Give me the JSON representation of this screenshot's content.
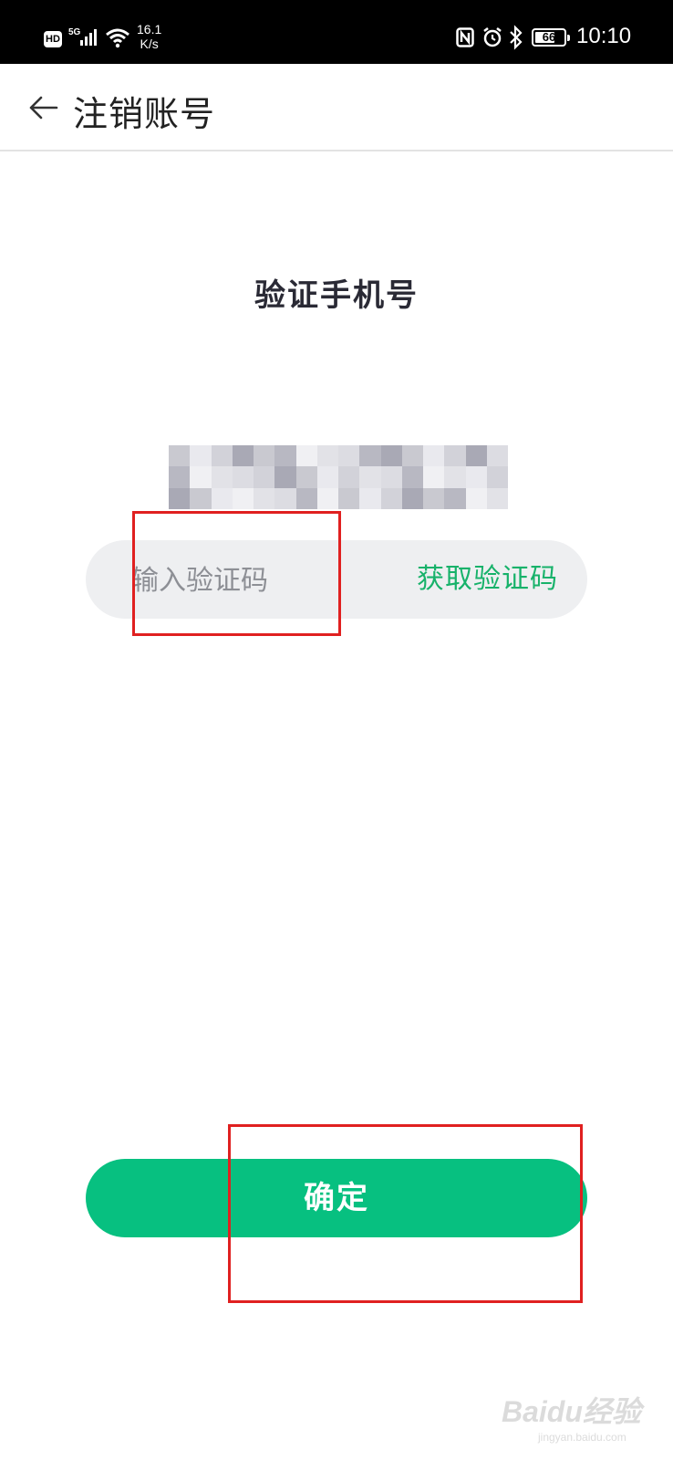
{
  "status_bar": {
    "hd": "HD",
    "network": "5G",
    "speed_value": "16.1",
    "speed_unit": "K/s",
    "battery": "66",
    "battery_level": 0.66,
    "time": "10:10",
    "icons": [
      "signal-icon",
      "wifi-icon",
      "nfc-icon",
      "alarm-icon",
      "bluetooth-icon",
      "battery-icon"
    ]
  },
  "header": {
    "back_icon": "arrow-left-icon",
    "title": "注销账号"
  },
  "main": {
    "subtitle": "验证手机号",
    "phone_masked": true,
    "code_input": {
      "placeholder": "输入验证码",
      "value": ""
    },
    "get_code_label": "获取验证码",
    "confirm_label": "确定"
  },
  "watermark": {
    "brand": "Baidu经验",
    "url": "jingyan.baidu.com"
  },
  "colors": {
    "accent": "#07c080",
    "link": "#17b26a",
    "annotation": "#e02020",
    "status_bar": "#000000"
  }
}
